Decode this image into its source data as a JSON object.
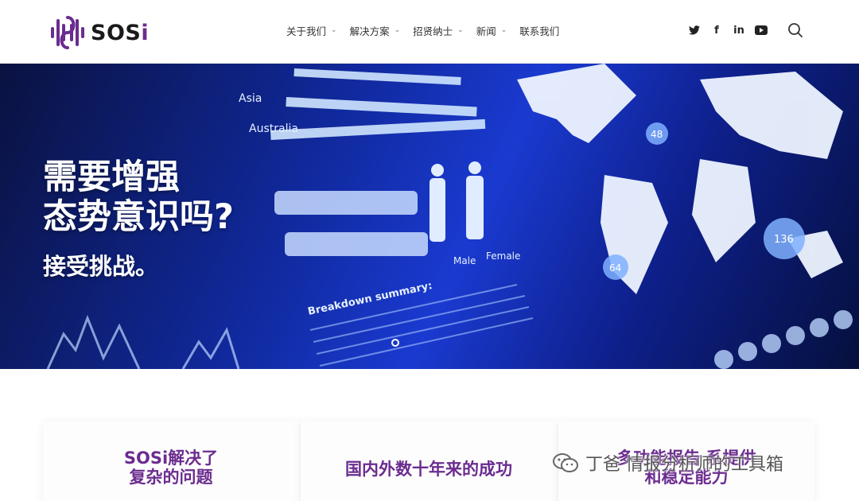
{
  "brand": {
    "name_main": "SOS",
    "name_accent": "i",
    "accent_color": "#6b2c8f",
    "logo_icon": "sosi-waveform-icon"
  },
  "nav": {
    "items": [
      {
        "label": "关于我们",
        "has_dropdown": true
      },
      {
        "label": "解决方案",
        "has_dropdown": true
      },
      {
        "label": "招贤纳士",
        "has_dropdown": true
      },
      {
        "label": "新闻",
        "has_dropdown": true
      },
      {
        "label": "联系我们",
        "has_dropdown": false
      }
    ]
  },
  "social": {
    "icons": [
      "twitter-icon",
      "facebook-icon",
      "linkedin-icon",
      "youtube-icon"
    ],
    "glyphs": [
      "t",
      "f",
      "in",
      "▶"
    ]
  },
  "search": {
    "icon": "search-icon"
  },
  "hero": {
    "title_line1": "需要增强",
    "title_line2": "态势意识吗?",
    "subtitle": "接受挑战。",
    "background_labels": {
      "asia": "Asia",
      "australia": "Australia",
      "male": "Male",
      "female": "Female",
      "breakdown": "Breakdown summary:",
      "num1": "48",
      "num2": "64",
      "num3": "136"
    }
  },
  "cards": [
    {
      "title_line1": "SOSi解决了",
      "title_line2": "复杂的问题"
    },
    {
      "title_line1": "国内外数十年来的成功",
      "title_line2": ""
    },
    {
      "title_line1": "多功能报告 系提供",
      "title_line2": "和稳定能力"
    }
  ],
  "watermark": {
    "text": "丁爸 情报分析师的工具箱",
    "icon": "wechat-icon"
  }
}
